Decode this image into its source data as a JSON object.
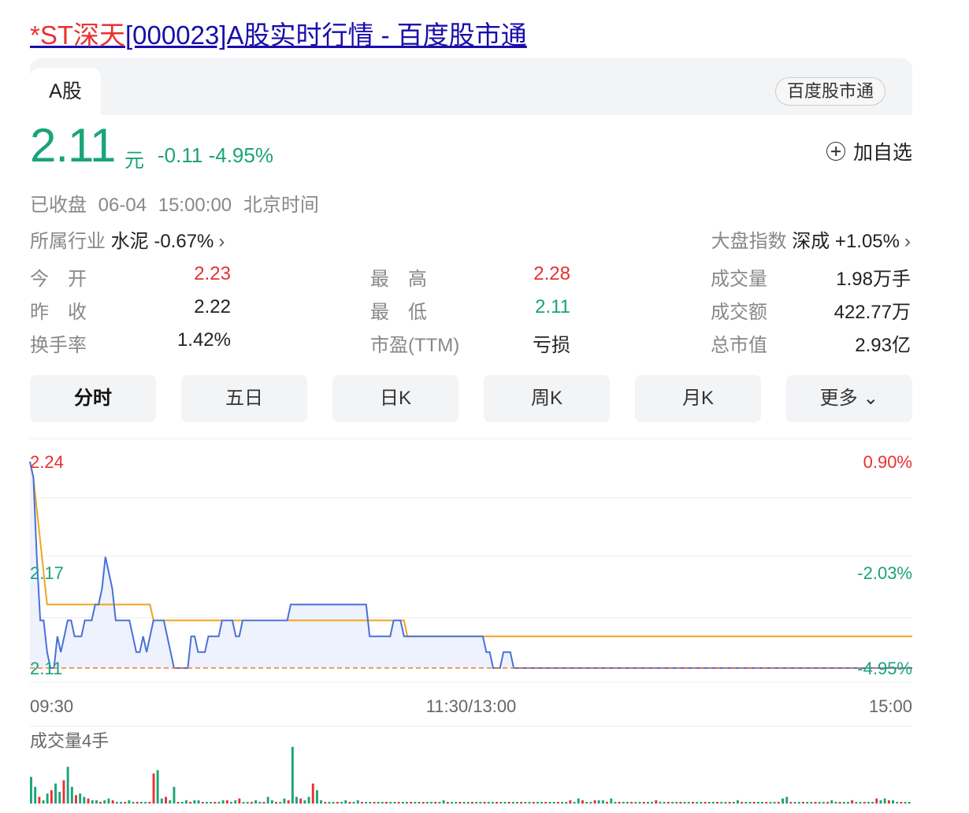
{
  "title": {
    "prefix": "*ST深天",
    "rest": "[000023]A股实时行情 - 百度股市通"
  },
  "tabs": {
    "active": "A股",
    "brand_pill": "百度股市通"
  },
  "quote": {
    "price": "2.11",
    "unit": "元",
    "change": "-0.11",
    "change_pct": "-4.95%",
    "add_watchlist": "加自选"
  },
  "status": {
    "state": "已收盘",
    "time": "06-04 15:00:00",
    "zone": "北京时间"
  },
  "industry": {
    "label": "所属行业",
    "value": "水泥 -0.67%"
  },
  "market_index": {
    "label": "大盘指数",
    "value": "深成 +1.05%"
  },
  "stats": [
    {
      "label": "今　开",
      "value": "2.23",
      "color": "#e93030"
    },
    {
      "label": "最　高",
      "value": "2.28",
      "color": "#e93030"
    },
    {
      "label": "成交量",
      "value": "1.98万手",
      "color": "#222222"
    },
    {
      "label": "昨　收",
      "value": "2.22",
      "color": "#222222"
    },
    {
      "label": "最　低",
      "value": "2.11",
      "color": "#1aa37a"
    },
    {
      "label": "成交额",
      "value": "422.77万",
      "color": "#222222"
    },
    {
      "label": "换手率",
      "value": "1.42%",
      "color": "#222222"
    },
    {
      "label": "市盈(TTM)",
      "value": "亏损",
      "color": "#222222"
    },
    {
      "label": "总市值",
      "value": "2.93亿",
      "color": "#222222"
    }
  ],
  "period_buttons": [
    "分时",
    "五日",
    "日K",
    "周K",
    "月K",
    "更多"
  ],
  "chart_data": {
    "type": "line",
    "y_left_ticks": [
      "2.24",
      "2.17",
      "2.11"
    ],
    "y_right_ticks": [
      "0.90%",
      "-2.03%",
      "-4.95%"
    ],
    "x_ticks": [
      "09:30",
      "11:30/13:00",
      "15:00"
    ],
    "ylim": [
      2.11,
      2.24
    ],
    "prev_close_line_value": 2.11,
    "series": [
      {
        "values": [
          2.24,
          2.23,
          2.21,
          2.19,
          2.17,
          2.15,
          2.15,
          2.15,
          2.15,
          2.15,
          2.15,
          2.15,
          2.15,
          2.15,
          2.15,
          2.15,
          2.15,
          2.15,
          2.15,
          2.15,
          2.15,
          2.15,
          2.15,
          2.15,
          2.15,
          2.15,
          2.15,
          2.15,
          2.15,
          2.15,
          2.15,
          2.15,
          2.15,
          2.15,
          2.15,
          2.15,
          2.14,
          2.14,
          2.14,
          2.14,
          2.14,
          2.14,
          2.14,
          2.14,
          2.14,
          2.14,
          2.14,
          2.14,
          2.14,
          2.14,
          2.14,
          2.14,
          2.14,
          2.14,
          2.14,
          2.14,
          2.14,
          2.14,
          2.14,
          2.14,
          2.14,
          2.14,
          2.14,
          2.14,
          2.14,
          2.14,
          2.14,
          2.14,
          2.14,
          2.14,
          2.14,
          2.14,
          2.14,
          2.14,
          2.14,
          2.14,
          2.14,
          2.14,
          2.14,
          2.14,
          2.14,
          2.14,
          2.14,
          2.14,
          2.14,
          2.14,
          2.14,
          2.14,
          2.14,
          2.14,
          2.14,
          2.14,
          2.14,
          2.14,
          2.14,
          2.14,
          2.14,
          2.14,
          2.14,
          2.14,
          2.14,
          2.14,
          2.14,
          2.14,
          2.14,
          2.14,
          2.14,
          2.14,
          2.14,
          2.14,
          2.13,
          2.13,
          2.13,
          2.13,
          2.13,
          2.13,
          2.13,
          2.13,
          2.13,
          2.13,
          2.13,
          2.13,
          2.13,
          2.13,
          2.13,
          2.13,
          2.13,
          2.13,
          2.13,
          2.13,
          2.13,
          2.13,
          2.13,
          2.13,
          2.13,
          2.13,
          2.13,
          2.13,
          2.13,
          2.13,
          2.13,
          2.13,
          2.13,
          2.13,
          2.13,
          2.13,
          2.13,
          2.13,
          2.13,
          2.13,
          2.13,
          2.13,
          2.13,
          2.13,
          2.13,
          2.13,
          2.13,
          2.13,
          2.13,
          2.13,
          2.13,
          2.13,
          2.13,
          2.13
        ]
      },
      {
        "values": [
          2.24,
          2.23,
          2.18,
          2.14,
          2.14,
          2.12,
          2.11,
          2.11,
          2.13,
          2.12,
          2.13,
          2.14,
          2.14,
          2.13,
          2.13,
          2.13,
          2.14,
          2.14,
          2.14,
          2.15,
          2.15,
          2.16,
          2.18,
          2.17,
          2.16,
          2.14,
          2.14,
          2.14,
          2.14,
          2.14,
          2.13,
          2.12,
          2.12,
          2.13,
          2.12,
          2.13,
          2.14,
          2.14,
          2.14,
          2.14,
          2.13,
          2.12,
          2.11,
          2.11,
          2.11,
          2.11,
          2.11,
          2.13,
          2.13,
          2.12,
          2.12,
          2.12,
          2.13,
          2.13,
          2.13,
          2.13,
          2.14,
          2.14,
          2.14,
          2.14,
          2.13,
          2.13,
          2.14,
          2.14,
          2.14,
          2.14,
          2.14,
          2.14,
          2.14,
          2.14,
          2.14,
          2.14,
          2.14,
          2.14,
          2.14,
          2.14,
          2.15,
          2.15,
          2.15,
          2.15,
          2.15,
          2.15,
          2.15,
          2.15,
          2.15,
          2.15,
          2.15,
          2.15,
          2.15,
          2.15,
          2.15,
          2.15,
          2.15,
          2.15,
          2.15,
          2.15,
          2.15,
          2.15,
          2.15,
          2.13,
          2.13,
          2.13,
          2.13,
          2.13,
          2.13,
          2.13,
          2.14,
          2.14,
          2.14,
          2.13,
          2.13,
          2.13,
          2.13,
          2.13,
          2.13,
          2.13,
          2.13,
          2.13,
          2.13,
          2.13,
          2.13,
          2.13,
          2.13,
          2.13,
          2.13,
          2.13,
          2.13,
          2.13,
          2.13,
          2.13,
          2.13,
          2.13,
          2.13,
          2.12,
          2.12,
          2.11,
          2.11,
          2.11,
          2.12,
          2.12,
          2.12,
          2.11,
          2.11,
          2.11,
          2.11,
          2.11,
          2.11,
          2.11,
          2.11,
          2.11,
          2.11,
          2.11,
          2.11,
          2.11,
          2.11,
          2.11,
          2.11,
          2.11,
          2.11,
          2.11,
          2.11,
          2.11,
          2.11
        ]
      }
    ],
    "volume_label": "成交量4手",
    "volumes": [
      16,
      10,
      4,
      2,
      6,
      8,
      12,
      7,
      14,
      22,
      10,
      5,
      6,
      4,
      3,
      2,
      2,
      1,
      2,
      3,
      2,
      1,
      1,
      1,
      2,
      1,
      1,
      1,
      1,
      1,
      18,
      20,
      3,
      4,
      2,
      10,
      1,
      1,
      2,
      1,
      2,
      2,
      1,
      1,
      1,
      1,
      1,
      2,
      2,
      1,
      2,
      3,
      1,
      1,
      1,
      2,
      1,
      1,
      4,
      2,
      1,
      1,
      3,
      2,
      34,
      4,
      3,
      2,
      4,
      12,
      8,
      2,
      1,
      1,
      1,
      1,
      1,
      2,
      1,
      1,
      2,
      1,
      1,
      1,
      1,
      1,
      1,
      1,
      1,
      1,
      1,
      1,
      1,
      1,
      1,
      1,
      1,
      1,
      1,
      1,
      1,
      2,
      1,
      1,
      1,
      1,
      1,
      1,
      1,
      1,
      1,
      1,
      1,
      1,
      1,
      1,
      1,
      1,
      1,
      1,
      1,
      1,
      1,
      1,
      1,
      1,
      1,
      1,
      1,
      1,
      1,
      1,
      2,
      1,
      3,
      2,
      1,
      1,
      2,
      2,
      2,
      1,
      3,
      1,
      1,
      1,
      1,
      1,
      1,
      1,
      1,
      1,
      1,
      2,
      1,
      1,
      1,
      1,
      1,
      1,
      1,
      1,
      1,
      1,
      1,
      1,
      1,
      1,
      1,
      1,
      1,
      1,
      1,
      2,
      1,
      1,
      1,
      1,
      1,
      1,
      1,
      1,
      1,
      1,
      3,
      4,
      1,
      1,
      1,
      1,
      1,
      1,
      1,
      1,
      1,
      1,
      2,
      1,
      1,
      1,
      1,
      2,
      1,
      1,
      1,
      1,
      1,
      3,
      2,
      3,
      2,
      2,
      1,
      1,
      1,
      1
    ],
    "volume_colors": [
      "#e93030",
      "#1aa37a"
    ]
  }
}
